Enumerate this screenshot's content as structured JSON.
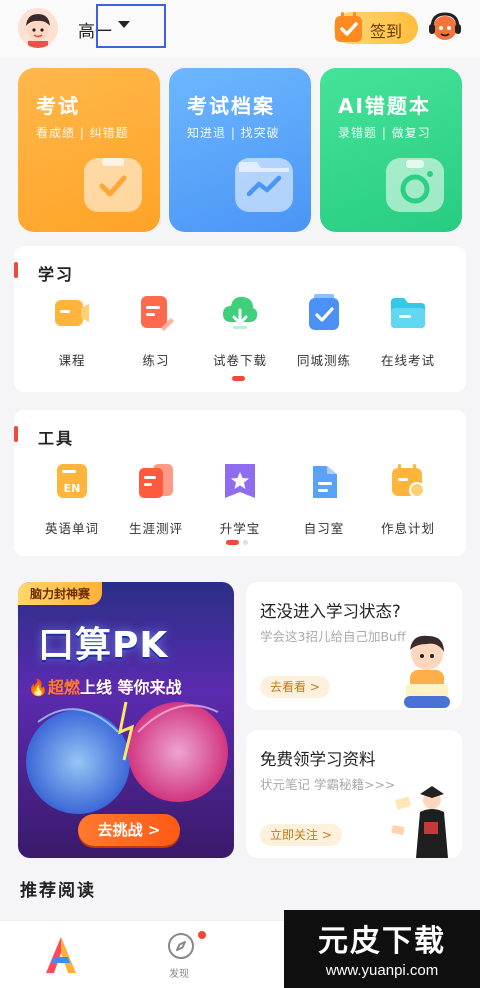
{
  "header": {
    "grade": "高一",
    "signin_label": "签到"
  },
  "cards": [
    {
      "title": "考试",
      "subtitle": "看成绩 | 纠错题"
    },
    {
      "title": "考试档案",
      "subtitle": "知进退 | 找突破"
    },
    {
      "title": "AI错题本",
      "subtitle": "录错题 | 做复习"
    }
  ],
  "study": {
    "title": "学习",
    "items": [
      {
        "label": "课程",
        "icon": "course-icon"
      },
      {
        "label": "练习",
        "icon": "practice-icon"
      },
      {
        "label": "试卷下载",
        "icon": "download-icon"
      },
      {
        "label": "同城测练",
        "icon": "local-test-icon"
      },
      {
        "label": "在线考试",
        "icon": "online-exam-icon"
      }
    ],
    "page": 1,
    "pages": 1
  },
  "tools": {
    "title": "工具",
    "items": [
      {
        "label": "英语单词",
        "icon": "english-words-icon",
        "badge": "EN"
      },
      {
        "label": "生涯测评",
        "icon": "career-assessment-icon"
      },
      {
        "label": "升学宝",
        "icon": "admission-icon"
      },
      {
        "label": "自习室",
        "icon": "study-room-icon"
      },
      {
        "label": "作息计划",
        "icon": "schedule-icon"
      }
    ],
    "page": 1,
    "pages": 2
  },
  "promo": {
    "tag": "脑力封神赛",
    "headline": "口算PK",
    "sub_fire": "超燃",
    "sub_rest": "上线 等你来战",
    "button": "去挑战 >"
  },
  "info_cards": [
    {
      "title": "还没进入学习状态?",
      "subtitle": "学会这3招儿给自己加Buff",
      "button": "去看看 >"
    },
    {
      "title": "免费领学习资料",
      "subtitle": "状元笔记 学霸秘籍>>>",
      "button": "立即关注 >"
    }
  ],
  "recommend_title": "推荐阅读",
  "nav": {
    "find_label": "发现"
  },
  "watermark": {
    "main": "元皮下载",
    "sub": "www.yuanpi.com"
  }
}
